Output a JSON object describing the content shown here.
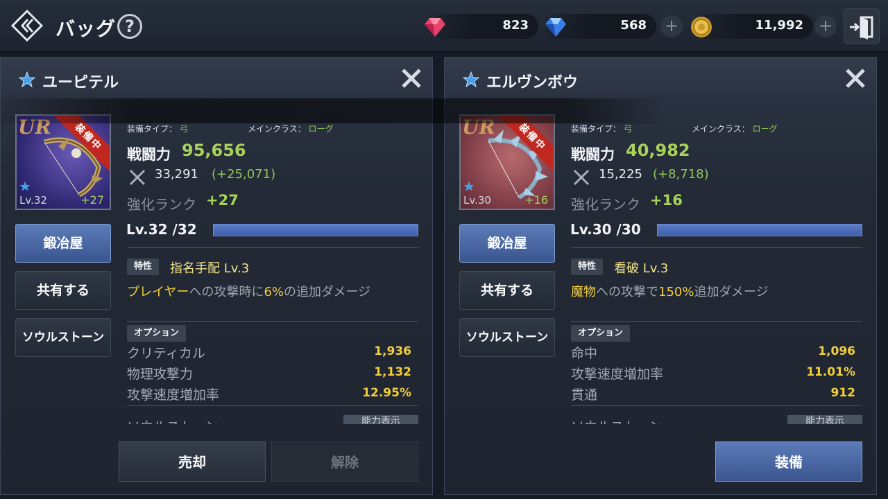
{
  "header": {
    "title": "バッグ",
    "help": "?"
  },
  "currency": [
    {
      "icon": "ruby-gem-icon",
      "value": "823"
    },
    {
      "icon": "sapphire-gem-icon",
      "value": "568"
    },
    {
      "icon": "gold-coin-icon",
      "value": "11,992"
    }
  ],
  "panels": [
    {
      "name": "ユーピテル",
      "rarity": "UR",
      "ribbon": "装備中",
      "level": "Lv.32",
      "plus": "+27",
      "type_label": "装備タイプ：",
      "type_value": "弓",
      "class_label": "メインクラス：",
      "class_value": "ローグ",
      "power_label": "戦闘力",
      "power_value": "95,656",
      "attack_value": "33,291",
      "attack_bonus": "(+25,071)",
      "rank_label": "強化ランク",
      "rank_value": "+27",
      "level_text": "Lv.32 /32",
      "level_progress": 1.0,
      "buttons": [
        "鍛冶屋",
        "共有する",
        "ソウルストーン"
      ],
      "trait_tag": "特性",
      "trait_name": "指名手配 Lv.3",
      "trait_desc": {
        "a": "プレイヤー",
        "b": "への攻撃時に",
        "c": "6%",
        "d": "の追加ダメージ"
      },
      "options_tag": "オプション",
      "options": [
        {
          "label": "クリティカル",
          "value": "1,936"
        },
        {
          "label": "物理攻撃力",
          "value": "1,132"
        },
        {
          "label": "攻撃速度増加率",
          "value": "12.95%"
        }
      ],
      "cut_text": "ソウルストーン",
      "cut_button": "能力表示",
      "bottom": [
        "売却",
        "解除"
      ]
    },
    {
      "name": "エルヴンボウ",
      "rarity": "UR",
      "ribbon": "装備中",
      "level": "Lv.30",
      "plus": "+16",
      "type_label": "装備タイプ：",
      "type_value": "弓",
      "class_label": "メインクラス：",
      "class_value": "ローグ",
      "power_label": "戦闘力",
      "power_value": "40,982",
      "attack_value": "15,225",
      "attack_bonus": "(+8,718)",
      "rank_label": "強化ランク",
      "rank_value": "+16",
      "level_text": "Lv.30 /30",
      "level_progress": 1.0,
      "buttons": [
        "鍛冶屋",
        "共有する",
        "ソウルストーン"
      ],
      "trait_tag": "特性",
      "trait_name": "看破 Lv.3",
      "trait_desc": {
        "a": "魔物",
        "b": "への攻撃で",
        "c": "150%",
        "d": "追加ダメージ"
      },
      "options_tag": "オプション",
      "options": [
        {
          "label": "命中",
          "value": "1,096"
        },
        {
          "label": "攻撃速度増加率",
          "value": "11.01%"
        },
        {
          "label": "貫通",
          "value": "912"
        }
      ],
      "cut_text": "ソウルストーン",
      "cut_button": "能力表示",
      "bottom": [
        "装備"
      ]
    }
  ],
  "colors": {
    "accent_green": "#a8d25a",
    "highlight_yellow": "#f2cf3a",
    "button_blue": "#4a68a4"
  }
}
